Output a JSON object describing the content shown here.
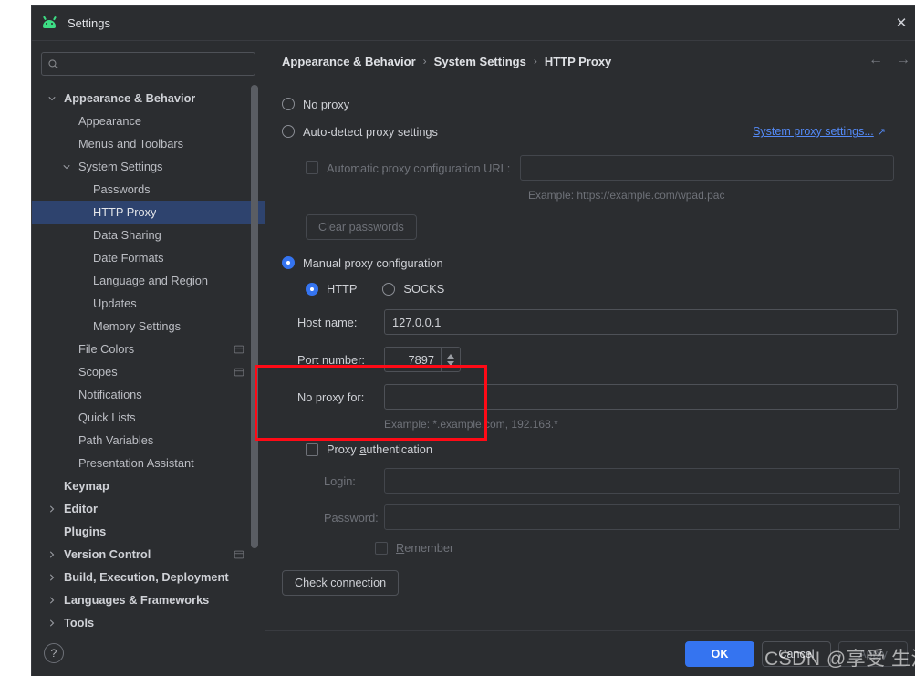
{
  "window": {
    "title": "Settings",
    "app_icon": "android-robot-icon",
    "close_label": "✕"
  },
  "search": {
    "placeholder": "",
    "value": "",
    "icon": "search-icon"
  },
  "sidebar": {
    "items": [
      {
        "label": "Appearance & Behavior",
        "indent": 0,
        "twisty": "down",
        "bold": true,
        "selected": false,
        "badge": false
      },
      {
        "label": "Appearance",
        "indent": 1,
        "twisty": "none",
        "bold": false,
        "selected": false,
        "badge": false
      },
      {
        "label": "Menus and Toolbars",
        "indent": 1,
        "twisty": "none",
        "bold": false,
        "selected": false,
        "badge": false
      },
      {
        "label": "System Settings",
        "indent": 1,
        "twisty": "down",
        "bold": false,
        "selected": false,
        "badge": false
      },
      {
        "label": "Passwords",
        "indent": 2,
        "twisty": "none",
        "bold": false,
        "selected": false,
        "badge": false
      },
      {
        "label": "HTTP Proxy",
        "indent": 2,
        "twisty": "none",
        "bold": false,
        "selected": true,
        "badge": false
      },
      {
        "label": "Data Sharing",
        "indent": 2,
        "twisty": "none",
        "bold": false,
        "selected": false,
        "badge": false
      },
      {
        "label": "Date Formats",
        "indent": 2,
        "twisty": "none",
        "bold": false,
        "selected": false,
        "badge": false
      },
      {
        "label": "Language and Region",
        "indent": 2,
        "twisty": "none",
        "bold": false,
        "selected": false,
        "badge": false
      },
      {
        "label": "Updates",
        "indent": 2,
        "twisty": "none",
        "bold": false,
        "selected": false,
        "badge": false
      },
      {
        "label": "Memory Settings",
        "indent": 2,
        "twisty": "none",
        "bold": false,
        "selected": false,
        "badge": false
      },
      {
        "label": "File Colors",
        "indent": 1,
        "twisty": "none",
        "bold": false,
        "selected": false,
        "badge": true
      },
      {
        "label": "Scopes",
        "indent": 1,
        "twisty": "none",
        "bold": false,
        "selected": false,
        "badge": true
      },
      {
        "label": "Notifications",
        "indent": 1,
        "twisty": "none",
        "bold": false,
        "selected": false,
        "badge": false
      },
      {
        "label": "Quick Lists",
        "indent": 1,
        "twisty": "none",
        "bold": false,
        "selected": false,
        "badge": false
      },
      {
        "label": "Path Variables",
        "indent": 1,
        "twisty": "none",
        "bold": false,
        "selected": false,
        "badge": false
      },
      {
        "label": "Presentation Assistant",
        "indent": 1,
        "twisty": "none",
        "bold": false,
        "selected": false,
        "badge": false
      },
      {
        "label": "Keymap",
        "indent": 0,
        "twisty": "none",
        "bold": true,
        "selected": false,
        "badge": false
      },
      {
        "label": "Editor",
        "indent": 0,
        "twisty": "right",
        "bold": true,
        "selected": false,
        "badge": false
      },
      {
        "label": "Plugins",
        "indent": 0,
        "twisty": "none",
        "bold": true,
        "selected": false,
        "badge": false
      },
      {
        "label": "Version Control",
        "indent": 0,
        "twisty": "right",
        "bold": true,
        "selected": false,
        "badge": true
      },
      {
        "label": "Build, Execution, Deployment",
        "indent": 0,
        "twisty": "right",
        "bold": true,
        "selected": false,
        "badge": false
      },
      {
        "label": "Languages & Frameworks",
        "indent": 0,
        "twisty": "right",
        "bold": true,
        "selected": false,
        "badge": false
      },
      {
        "label": "Tools",
        "indent": 0,
        "twisty": "right",
        "bold": true,
        "selected": false,
        "badge": false
      }
    ],
    "help_button": "?"
  },
  "breadcrumb": {
    "parts": [
      "Appearance & Behavior",
      "System Settings",
      "HTTP Proxy"
    ],
    "separator": "›",
    "back_arrow": "←",
    "forward_arrow": "→"
  },
  "proxy": {
    "no_proxy_label": "No proxy",
    "auto_detect_label": "Auto-detect proxy settings",
    "system_proxy_link": "System proxy settings...",
    "system_proxy_link_external_icon": "↗",
    "auto_config_url_label": "Automatic proxy configuration URL:",
    "auto_config_url_value": "",
    "auto_config_example": "Example: https://example.com/wpad.pac",
    "clear_passwords_label": "Clear passwords",
    "manual_label": "Manual proxy configuration",
    "http_label": "HTTP",
    "socks_label": "SOCKS",
    "host_name_label": "Host name:",
    "host_name_value": "127.0.0.1",
    "port_number_label": "Port number:",
    "port_number_value": "7897",
    "no_proxy_for_label": "No proxy for:",
    "no_proxy_for_value": "",
    "no_proxy_for_example": "Example: *.example.com, 192.168.*",
    "proxy_auth_label": "Proxy authentication",
    "login_label": "Login:",
    "login_value": "",
    "password_label": "Password:",
    "password_value": "",
    "remember_label": "Remember",
    "check_connection_label": "Check connection",
    "selected_mode": "manual",
    "selected_protocol": "http"
  },
  "footer": {
    "ok_label": "OK",
    "cancel_label": "Cancel",
    "apply_label": "Apply"
  },
  "annotation": {
    "highlight_color": "#ff0a16"
  },
  "watermark": {
    "text": "CSDN @享受 生活"
  },
  "colors": {
    "accent": "#3574f0",
    "selection": "#2e436e",
    "link": "#548af7",
    "panel": "#2b2d30",
    "text": "#cfd1d6"
  }
}
